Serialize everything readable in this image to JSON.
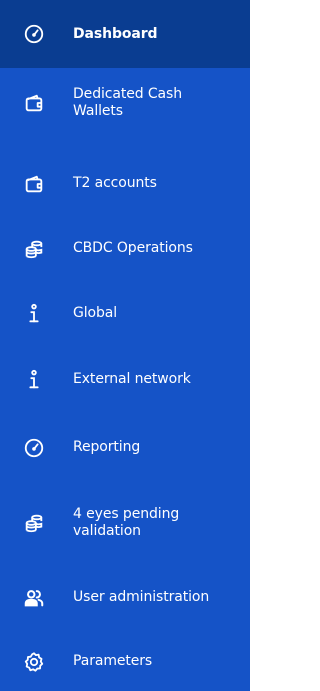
{
  "sidebar": {
    "items": [
      {
        "label": "Dashboard",
        "icon": "dashboard-gauge-icon",
        "active": true
      },
      {
        "label": "Dedicated Cash\nWallets",
        "icon": "wallet-icon",
        "active": false
      },
      {
        "label": "T2 accounts",
        "icon": "wallet-icon",
        "active": false
      },
      {
        "label": "CBDC Operations",
        "icon": "coin-stack-icon",
        "active": false
      },
      {
        "label": "Global",
        "icon": "info-icon",
        "active": false
      },
      {
        "label": "External network",
        "icon": "info-icon",
        "active": false
      },
      {
        "label": "Reporting",
        "icon": "gauge-icon",
        "active": false
      },
      {
        "label": "4 eyes pending\nvalidation",
        "icon": "coin-stack-icon",
        "active": false
      },
      {
        "label": "User administration",
        "icon": "users-icon",
        "active": false
      },
      {
        "label": "Parameters",
        "icon": "gear-icon",
        "active": false
      }
    ]
  },
  "colors": {
    "sidebar_bg": "#1553c7",
    "active_bg": "#0a3d91",
    "text": "#ffffff"
  }
}
